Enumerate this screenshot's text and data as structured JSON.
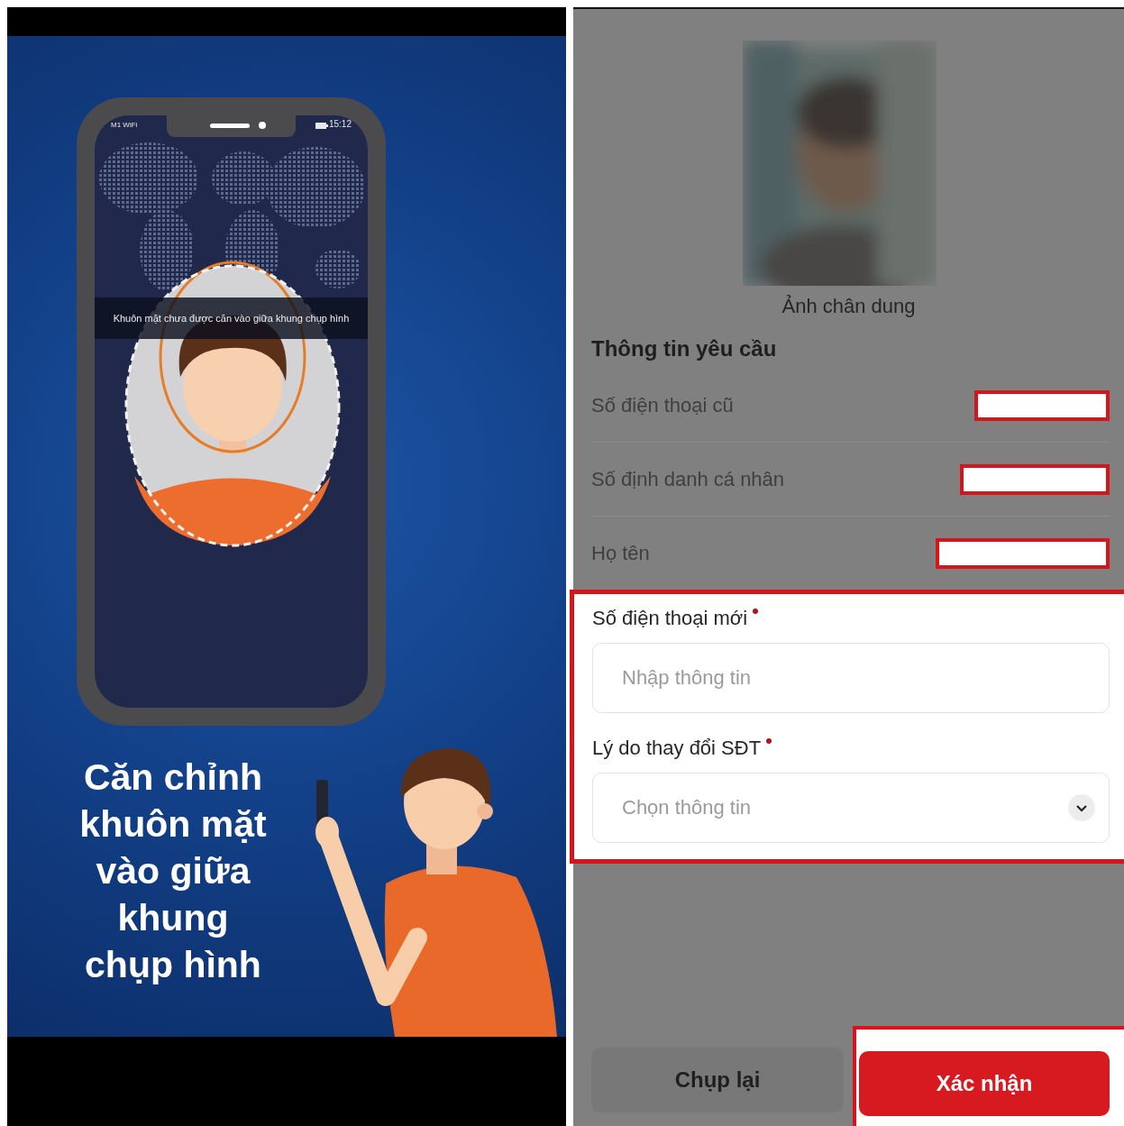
{
  "instruction_screen": {
    "status_bar": {
      "carrier": "M1 WiFi",
      "time": "15:12"
    },
    "hint": "Khuôn mặt chưa được căn vào giữa khung chụp hình",
    "title": "Căn chỉnh khuôn mặt vào giữa khung chụp hình"
  },
  "form_screen": {
    "portrait": {
      "kind": "picture",
      "caption": "Ảnh chân dung"
    },
    "section_title": "Thông tin yêu cầu",
    "info_rows": [
      {
        "label": "Số điện thoại cũ",
        "redacted": true
      },
      {
        "label": "Số định danh cá nhân",
        "redacted": true
      },
      {
        "label": "Họ tên",
        "redacted": true
      }
    ],
    "request_form": {
      "highlighted": true,
      "fields": [
        {
          "kind": "text",
          "label": "Số điện thoại mới",
          "required": true,
          "placeholder": "Nhập thông tin"
        },
        {
          "kind": "select",
          "label": "Lý do thay đổi SĐT",
          "required": true,
          "placeholder": "Chọn thông tin"
        }
      ]
    },
    "buttons": [
      {
        "label": "Chụp lại",
        "kind": "secondary",
        "highlighted": false
      },
      {
        "label": "Xác nhận",
        "kind": "primary",
        "highlighted": true
      }
    ]
  }
}
